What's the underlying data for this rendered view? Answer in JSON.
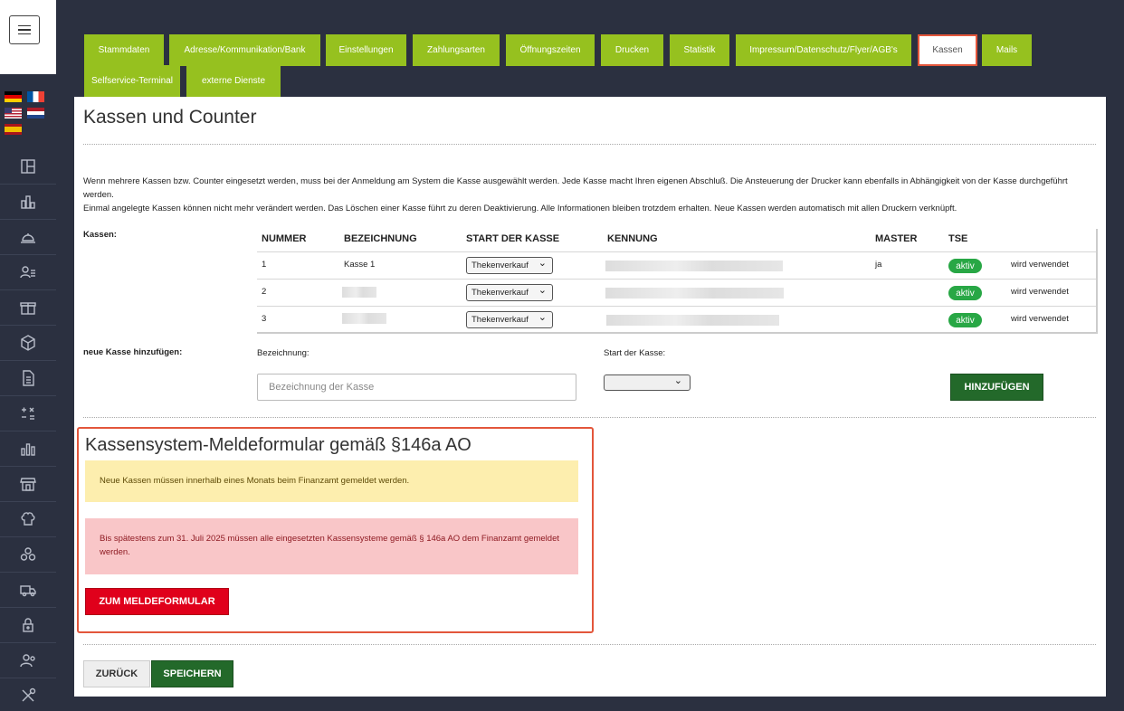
{
  "languages": [
    "Deutsch",
    "Français",
    "English",
    "Nederlands",
    "Español"
  ],
  "sidebar": {
    "items": [
      {
        "icon": "layout-icon"
      },
      {
        "icon": "bar-chart-icon"
      },
      {
        "icon": "cloche-icon"
      },
      {
        "icon": "users-list-icon"
      },
      {
        "icon": "gift-icon"
      },
      {
        "icon": "box-icon"
      },
      {
        "icon": "document-icon"
      },
      {
        "icon": "calculator-icon"
      },
      {
        "icon": "stats-icon"
      },
      {
        "icon": "store-icon"
      },
      {
        "icon": "chef-hat-icon"
      },
      {
        "icon": "group-icon"
      },
      {
        "icon": "truck-icon"
      },
      {
        "icon": "lock-icon"
      },
      {
        "icon": "user-admin-icon"
      },
      {
        "icon": "tools-icon"
      }
    ]
  },
  "tabs": [
    {
      "label": "Stammdaten"
    },
    {
      "label": "Adresse/Kommunikation/Bank"
    },
    {
      "label": "Einstellungen"
    },
    {
      "label": "Zahlungsarten"
    },
    {
      "label": "Öffnungszeiten"
    },
    {
      "label": "Drucken"
    },
    {
      "label": "Statistik"
    },
    {
      "label": "Impressum/Datenschutz/Flyer/AGB's"
    },
    {
      "label": "Kassen",
      "active": true
    },
    {
      "label": "Mails"
    },
    {
      "label": "Selfservice-Terminal"
    },
    {
      "label": "externe Dienste"
    }
  ],
  "page": {
    "title": "Kassen und Counter",
    "info_line1": "Wenn mehrere Kassen bzw. Counter eingesetzt werden, muss bei der Anmeldung am System die Kasse ausgewählt werden. Jede Kasse macht Ihren eigenen Abschluß. Die Ansteuerung der Drucker kann ebenfalls in Abhängigkeit von der Kasse durchgeführt werden.",
    "info_line2": "Einmal angelegte Kassen können nicht mehr verändert werden. Das Löschen einer Kasse führt zu deren Deaktivierung. Alle Informationen bleiben trotzdem erhalten. Neue Kassen werden automatisch mit allen Druckern verknüpft.",
    "kassen_label": "Kassen:"
  },
  "table": {
    "headers": [
      "NUMMER",
      "BEZEICHNUNG",
      "START DER KASSE",
      "KENNUNG",
      "MASTER",
      "TSE"
    ],
    "rows": [
      {
        "nummer": "1",
        "bezeichnung": "Kasse 1",
        "start": "Thekenverkauf",
        "master": "ja",
        "tse": "aktiv",
        "status": "wird verwendet"
      },
      {
        "nummer": "2",
        "bezeichnung": "",
        "start": "Thekenverkauf",
        "master": "",
        "tse": "aktiv",
        "status": "wird verwendet"
      },
      {
        "nummer": "3",
        "bezeichnung": "",
        "start": "Thekenverkauf",
        "master": "",
        "tse": "aktiv",
        "status": "wird verwendet"
      }
    ]
  },
  "new_kasse": {
    "label": "neue Kasse hinzufügen:",
    "bezeichnung_label": "Bezeichnung:",
    "bezeichnung_placeholder": "Bezeichnung der Kasse",
    "start_label": "Start der Kasse:",
    "start_value": "",
    "add_button": "HINZUFÜGEN"
  },
  "melde": {
    "title": "Kassensystem-Meldeformular gemäß §146a AO",
    "warning": "Neue Kassen müssen innerhalb eines Monats beim Finanzamt gemeldet werden.",
    "danger": "Bis spätestens zum 31. Juli 2025 müssen alle eingesetzten Kassensysteme gemäß § 146a AO dem Finanzamt gemeldet werden.",
    "button": "ZUM MELDEFORMULAR"
  },
  "footer": {
    "back_button": "ZURÜCK",
    "save_button": "SPEICHERN"
  },
  "colors": {
    "tab_green": "#96c11f",
    "active_border": "#e3563b",
    "save_green": "#23692a",
    "tse_badge": "#28a745",
    "cta_red": "#e0001b",
    "sidebar_bg": "#2b3040"
  }
}
